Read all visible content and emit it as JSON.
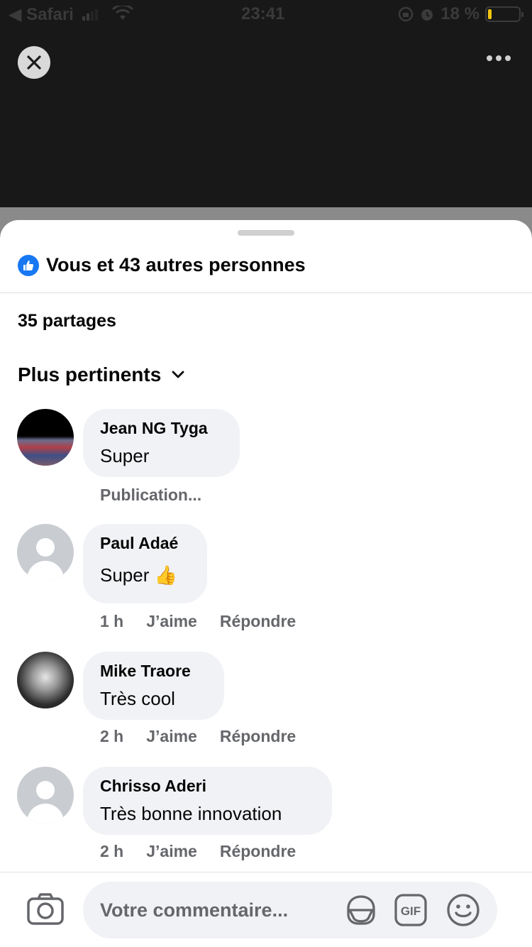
{
  "status_bar": {
    "back_app": "◀ Safari",
    "time": "23:41",
    "battery": "18 %",
    "battery_level": 0.18
  },
  "post": {
    "likes_text": "Vous et 43 autres personnes",
    "shares_text": "35 partages",
    "sort_label": "Plus pertinents"
  },
  "comments": [
    {
      "author": "Jean NG Tyga",
      "text": "Super",
      "status": "Publication..."
    },
    {
      "author": "Paul Adaé",
      "text": "Super 👍",
      "time": "1 h",
      "like": "J’aime",
      "reply": "Répondre"
    },
    {
      "author": "Mike Traore",
      "text": "Très cool",
      "time": "2 h",
      "like": "J’aime",
      "reply": "Répondre"
    },
    {
      "author": "Chrisso Aderi",
      "text": "Très bonne innovation",
      "time": "2 h",
      "like": "J’aime",
      "reply": "Répondre"
    }
  ],
  "composer": {
    "placeholder": "Votre commentaire..."
  },
  "colors": {
    "accent": "#1877f2",
    "bubble": "#f0f2f5",
    "meta_text": "#65676b"
  },
  "icons": [
    "close-icon",
    "more-icon",
    "like-icon",
    "chevron-down-icon",
    "camera-icon",
    "sticker-icon",
    "gif-icon",
    "emoji-icon"
  ]
}
